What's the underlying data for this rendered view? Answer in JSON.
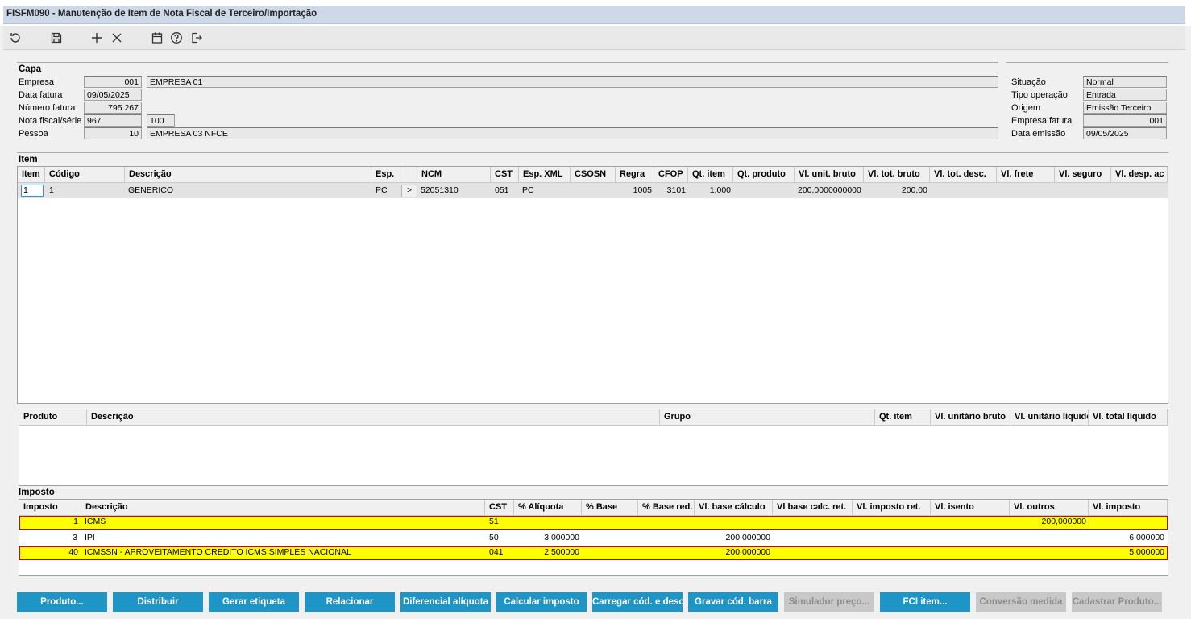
{
  "window": {
    "title": "FISFM090 - Manutenção de Item de Nota Fiscal de Terceiro/Importação"
  },
  "toolbar": [
    {
      "icon": "refresh-icon"
    },
    {
      "icon": "save-icon"
    },
    {
      "icon": "add-icon"
    },
    {
      "icon": "delete-icon"
    },
    {
      "icon": "calendar-icon"
    },
    {
      "icon": "help-icon"
    },
    {
      "icon": "exit-icon"
    }
  ],
  "capa": {
    "title": "Capa",
    "empresa_label": "Empresa",
    "empresa_code": "001",
    "empresa_name": "EMPRESA 01",
    "data_fatura_label": "Data fatura",
    "data_fatura": "09/05/2025",
    "numero_fatura_label": "Número fatura",
    "numero_fatura": "795.267",
    "nota_serie_label": "Nota fiscal/série",
    "nota_fiscal": "967",
    "serie": "100",
    "pessoa_label": "Pessoa",
    "pessoa_code": "10",
    "pessoa_name": "EMPRESA 03 NFCE"
  },
  "status": {
    "situacao_label": "Situação",
    "situacao": "Normal",
    "tipo_operacao_label": "Tipo operação",
    "tipo_operacao": "Entrada",
    "origem_label": "Origem",
    "origem": "Emissão Terceiro",
    "empresa_fatura_label": "Empresa fatura",
    "empresa_fatura": "001",
    "data_emissao_label": "Data emissão",
    "data_emissao": "09/05/2025"
  },
  "item": {
    "title": "Item",
    "columns": [
      "Item",
      "Código",
      "Descrição",
      "Esp.",
      "",
      "NCM",
      "CST",
      "Esp. XML",
      "CSOSN",
      "Regra",
      "CFOP",
      "Qt. item",
      "Qt. produto",
      "Vl. unit. bruto",
      "Vl. tot. bruto",
      "Vl. tot. desc.",
      "Vl. frete",
      "Vl. seguro",
      "Vl. desp. ac"
    ],
    "rows": [
      {
        "item": "1",
        "codigo": "1",
        "descricao": "GENERICO",
        "esp": "PC",
        "btn": ">",
        "ncm": "52051310",
        "cst": "051",
        "esp_xml": "PC",
        "csosn": "",
        "regra": "1005",
        "cfop": "3101",
        "qt_item": "1,000",
        "qt_produto": "",
        "vl_unit_bruto": "200,0000000000",
        "vl_tot_bruto": "200,00",
        "vl_tot_desc": "",
        "vl_frete": "",
        "vl_seguro": "",
        "vl_desp": ""
      }
    ]
  },
  "produto": {
    "columns": [
      "Produto",
      "Descrição",
      "Grupo",
      "Qt. item",
      "Vl. unitário bruto",
      "Vl. unitário líquido",
      "Vl. total líquido"
    ]
  },
  "imposto": {
    "title": "Imposto",
    "columns": [
      "Imposto",
      "Descrição",
      "CST",
      "% Alíquota",
      "% Base",
      "% Base red.",
      "Vl. base cálculo",
      "Vl base calc. ret.",
      "Vl. imposto ret.",
      "Vl. isento",
      "Vl. outros",
      "Vl. imposto"
    ],
    "rows": [
      {
        "imposto": "1",
        "descricao": "ICMS",
        "cst": "51",
        "aliquota": "",
        "base": "",
        "base_red": "",
        "base_calc": "",
        "base_calc_ret": "",
        "imposto_ret": "",
        "isento": "",
        "outros": "200,000000",
        "vl_imposto": "",
        "highlight": true
      },
      {
        "imposto": "3",
        "descricao": "IPI",
        "cst": "50",
        "aliquota": "3,000000",
        "base": "",
        "base_red": "",
        "base_calc": "200,000000",
        "base_calc_ret": "",
        "imposto_ret": "",
        "isento": "",
        "outros": "",
        "vl_imposto": "6,000000",
        "highlight": false
      },
      {
        "imposto": "40",
        "descricao": "ICMSSN - APROVEITAMENTO CREDITO ICMS SIMPLES NACIONAL",
        "cst": "041",
        "aliquota": "2,500000",
        "base": "",
        "base_red": "",
        "base_calc": "200,000000",
        "base_calc_ret": "",
        "imposto_ret": "",
        "isento": "",
        "outros": "",
        "vl_imposto": "5,000000",
        "highlight": true
      }
    ]
  },
  "buttons": [
    {
      "label": "Produto...",
      "enabled": true
    },
    {
      "label": "Distribuir",
      "enabled": true
    },
    {
      "label": "Gerar etiqueta",
      "enabled": true
    },
    {
      "label": "Relacionar",
      "enabled": true
    },
    {
      "label": "Diferencial alíquota",
      "enabled": true
    },
    {
      "label": "Calcular imposto",
      "enabled": true
    },
    {
      "label": "Carregar cód. e desc.",
      "enabled": true
    },
    {
      "label": "Gravar cód. barra",
      "enabled": true
    },
    {
      "label": "Simulador preço...",
      "enabled": false
    },
    {
      "label": "FCI item...",
      "enabled": true
    },
    {
      "label": "Conversão medida",
      "enabled": false
    },
    {
      "label": "Cadastrar Produto...",
      "enabled": false
    }
  ],
  "colors": {
    "title_bg": "#cdd9e8",
    "button": "#1f95c7",
    "highlight_row": "#ffff00",
    "highlight_border": "#d00000"
  }
}
